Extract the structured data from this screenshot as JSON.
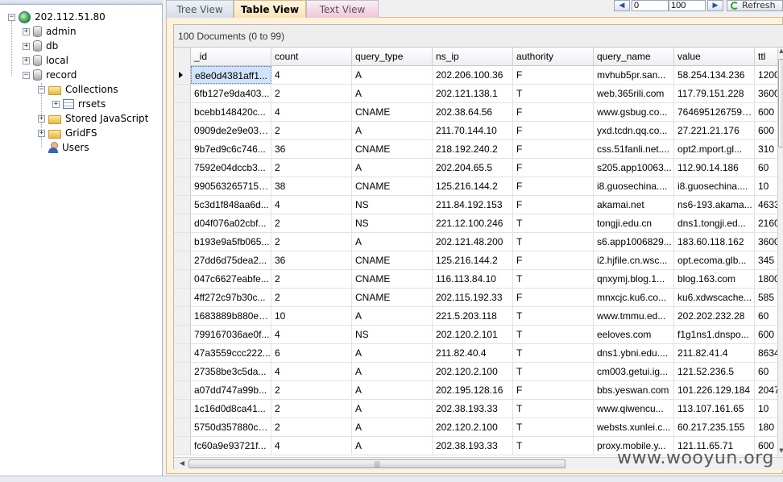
{
  "tree": {
    "server": "202.112.51.80",
    "databases": [
      "admin",
      "db",
      "local",
      "record"
    ],
    "collections_label": "Collections",
    "collection": "rrsets",
    "stored_js": "Stored JavaScript",
    "gridfs": "GridFS",
    "users": "Users"
  },
  "tabs": [
    {
      "label": "Tree View"
    },
    {
      "label": "Table View"
    },
    {
      "label": "Text View"
    }
  ],
  "nav": {
    "skip": "0",
    "limit": "100",
    "refresh": "Refresh"
  },
  "result": {
    "count_label": "100 Documents (0 to 99)"
  },
  "columns": [
    "_id",
    "count",
    "query_type",
    "ns_ip",
    "authority",
    "query_name",
    "value",
    "ttl"
  ],
  "rows": [
    [
      "e8e0d4381aff1...",
      "4",
      "A",
      "202.206.100.36",
      "F",
      "mvhub5pr.san...",
      "58.254.134.236",
      "1200"
    ],
    [
      "6fb127e9da403...",
      "2",
      "A",
      "202.121.138.1",
      "T",
      "web.365rili.com",
      "117.79.151.228",
      "3600"
    ],
    [
      "bcebb148420c...",
      "4",
      "CNAME",
      "202.38.64.56",
      "F",
      "www.gsbug.co...",
      "7646951267597...",
      "600"
    ],
    [
      "0909de2e9e03a...",
      "2",
      "A",
      "211.70.144.10",
      "F",
      "yxd.tcdn.qq.co...",
      "27.221.21.176",
      "600"
    ],
    [
      "9b7ed9c6c746...",
      "36",
      "CNAME",
      "218.192.240.2",
      "F",
      "css.51fanli.net....",
      "opt2.mport.gl...",
      "310"
    ],
    [
      "7592e04dccb3...",
      "2",
      "A",
      "202.204.65.5",
      "F",
      "s205.app10063...",
      "112.90.14.186",
      "60"
    ],
    [
      "990563265715c...",
      "38",
      "CNAME",
      "125.216.144.2",
      "F",
      "i8.guosechina....",
      "i8.guosechina....",
      "10"
    ],
    [
      "5c3d1f848aa6d...",
      "4",
      "NS",
      "211.84.192.153",
      "F",
      "akamai.net",
      "ns6-193.akama...",
      "4633"
    ],
    [
      "d04f076a02cbf...",
      "2",
      "NS",
      "221.12.100.246",
      "T",
      "tongji.edu.cn",
      "dns1.tongji.ed...",
      "2160"
    ],
    [
      "b193e9a5fb065...",
      "2",
      "A",
      "202.121.48.200",
      "T",
      "s6.app1006829...",
      "183.60.118.162",
      "3600"
    ],
    [
      "27dd6d75dea2...",
      "36",
      "CNAME",
      "125.216.144.2",
      "F",
      "i2.hjfile.cn.wsc...",
      "opt.ecoma.glb...",
      "345"
    ],
    [
      "047c6627eabfe...",
      "2",
      "CNAME",
      "116.113.84.10",
      "T",
      "qnxymj.blog.1...",
      "blog.163.com",
      "1800"
    ],
    [
      "4ff272c97b30c...",
      "2",
      "CNAME",
      "202.115.192.33",
      "F",
      "mnxcjc.ku6.co...",
      "ku6.xdwscache...",
      "585"
    ],
    [
      "1683889b880e5...",
      "10",
      "A",
      "221.5.203.118",
      "T",
      "www.tmmu.ed...",
      "202.202.232.28",
      "60"
    ],
    [
      "799167036ae0f...",
      "4",
      "NS",
      "202.120.2.101",
      "T",
      "eeloves.com",
      "f1g1ns1.dnspo...",
      "600"
    ],
    [
      "47a3559ccc222...",
      "6",
      "A",
      "211.82.40.4",
      "T",
      "dns1.ybni.edu....",
      "211.82.41.4",
      "8634"
    ],
    [
      "27358be3c5da...",
      "4",
      "A",
      "202.120.2.100",
      "T",
      "cm003.getui.ig...",
      "121.52.236.5",
      "60"
    ],
    [
      "a07dd747a99b...",
      "2",
      "A",
      "202.195.128.16",
      "F",
      "bbs.yeswan.com",
      "101.226.129.184",
      "2047"
    ],
    [
      "1c16d0d8ca41...",
      "2",
      "A",
      "202.38.193.33",
      "T",
      "www.qiwencu...",
      "113.107.161.65",
      "10"
    ],
    [
      "5750d357880ca...",
      "2",
      "A",
      "202.120.2.100",
      "T",
      "websts.xunlei.c...",
      "60.217.235.155",
      "180"
    ],
    [
      "fc60a9e93721f...",
      "4",
      "A",
      "202.38.193.33",
      "T",
      "proxy.mobile.y...",
      "121.11.65.71",
      "600"
    ]
  ],
  "watermark": "www.wooyun.org"
}
